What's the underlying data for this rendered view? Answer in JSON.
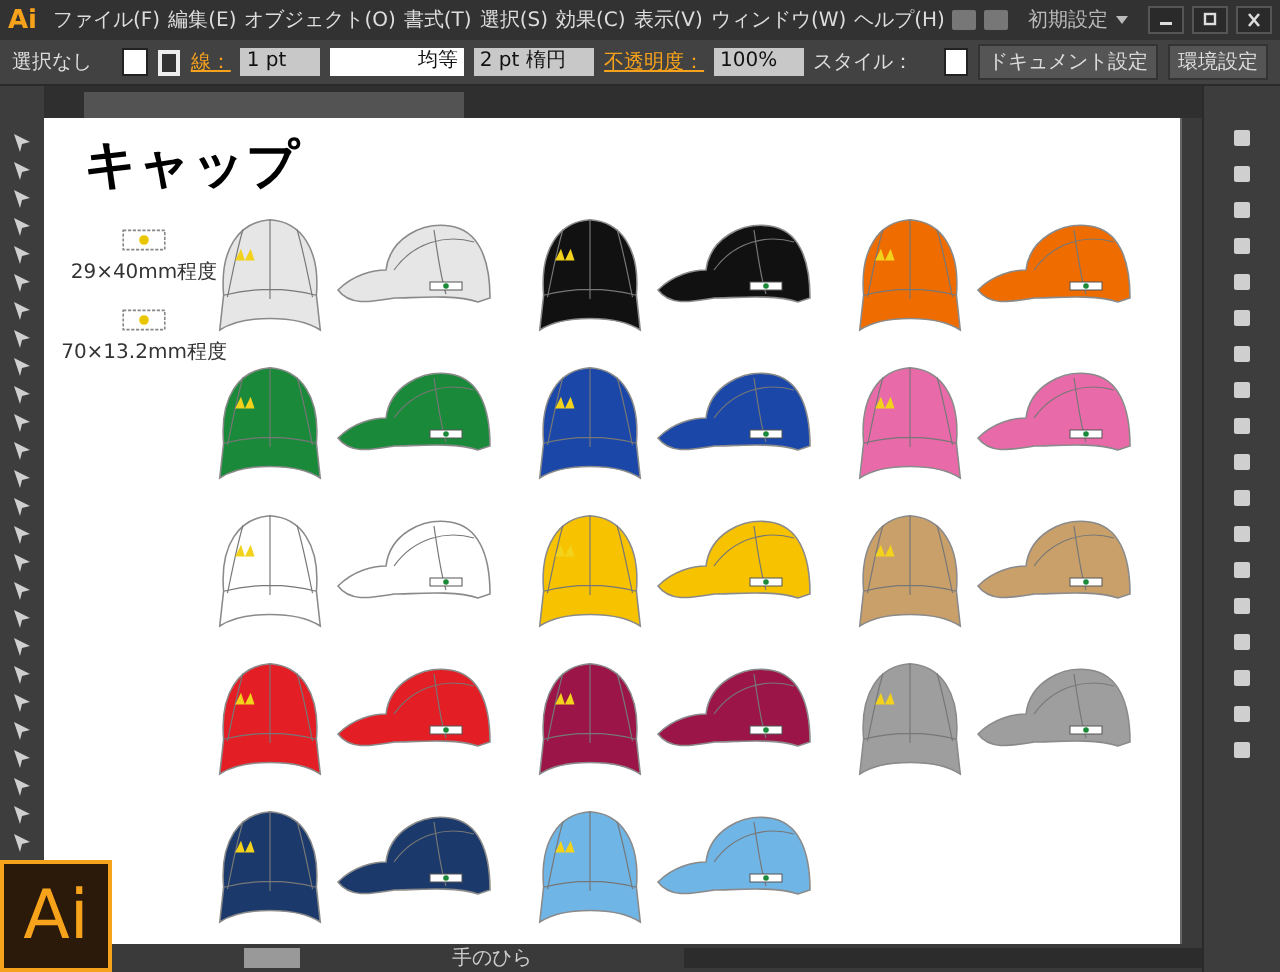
{
  "app": {
    "logo": "Ai",
    "workspace": "初期設定",
    "badge": "Ai"
  },
  "menu": [
    "ファイル(F)",
    "編集(E)",
    "オブジェクト(O)",
    "書式(T)",
    "選択(S)",
    "効果(C)",
    "表示(V)",
    "ウィンドウ(W)",
    "ヘルプ(H)"
  ],
  "control_bar": {
    "selection": "選択なし",
    "stroke_label": "線：",
    "stroke_weight": "1 pt",
    "profile": "均等",
    "brush": "2 pt 楕円",
    "opacity_label": "不透明度：",
    "opacity": "100%",
    "style_label": "スタイル：",
    "buttons": [
      "ドキュメント設定",
      "環境設定"
    ]
  },
  "artboard": {
    "title": "キャップ",
    "size_notes": [
      "29×40mm程度",
      "70×13.2mm程度"
    ],
    "caps": [
      {
        "color": "#e6e6e6"
      },
      {
        "color": "#111111"
      },
      {
        "color": "#ef6c00"
      },
      {
        "color": "#1a8a3a"
      },
      {
        "color": "#1a47a8"
      },
      {
        "color": "#e96aa8"
      },
      {
        "color": "#ffffff"
      },
      {
        "color": "#f7c200"
      },
      {
        "color": "#c9a06a"
      },
      {
        "color": "#e31e24"
      },
      {
        "color": "#9b1548"
      },
      {
        "color": "#9e9e9e"
      },
      {
        "color": "#1b3a6b"
      },
      {
        "color": "#6fb5e6"
      }
    ]
  },
  "status_bar": {
    "tool": "手のひら"
  }
}
